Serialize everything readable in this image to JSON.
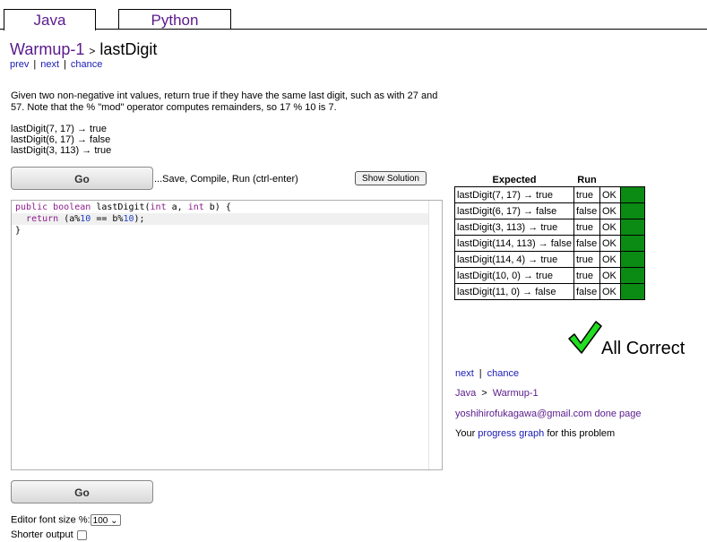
{
  "tabs": [
    {
      "label": "Java"
    },
    {
      "label": "Python"
    }
  ],
  "breadcrumb": {
    "section": "Warmup-1",
    "separator": ">",
    "problem": "lastDigit"
  },
  "nav": {
    "prev": "prev",
    "next": "next",
    "chance": "chance",
    "divider": "|"
  },
  "description": "Given two non-negative int values, return true if they have the same last digit, such as with 27 and 57. Note that the % \"mod\" operator computes remainders, so 17 % 10 is 7.",
  "examples": [
    "lastDigit(7, 17) → true",
    "lastDigit(6, 17) → false",
    "lastDigit(3, 113) → true"
  ],
  "toolbar": {
    "go_label": "Go",
    "save_hint": "...Save, Compile, Run (ctrl-enter)",
    "show_solution_label": "Show Solution"
  },
  "code": {
    "line1": {
      "kw": "public boolean",
      "name": " lastDigit(",
      "t1": "int",
      "a": " a, ",
      "t2": "int",
      "b": " b) {"
    },
    "line2": {
      "kw": "return",
      "p1": " (a%",
      "n1": "10",
      "p2": " == b%",
      "n2": "10",
      "p3": ");"
    },
    "line3": "}"
  },
  "options": {
    "font_size_label": "Editor font size %:",
    "font_size_value": "100",
    "shorter_output_label": "Shorter output"
  },
  "results": {
    "headers": {
      "expected": "Expected",
      "run": "Run"
    },
    "rows": [
      {
        "expected": "lastDigit(7, 17) → true",
        "run": "true",
        "status": "OK"
      },
      {
        "expected": "lastDigit(6, 17) → false",
        "run": "false",
        "status": "OK"
      },
      {
        "expected": "lastDigit(3, 113) → true",
        "run": "true",
        "status": "OK"
      },
      {
        "expected": "lastDigit(114, 113) → false",
        "run": "false",
        "status": "OK"
      },
      {
        "expected": "lastDigit(114, 4) → true",
        "run": "true",
        "status": "OK"
      },
      {
        "expected": "lastDigit(10, 0) → true",
        "run": "true",
        "status": "OK"
      },
      {
        "expected": "lastDigit(11, 0) → false",
        "run": "false",
        "status": "OK"
      }
    ],
    "pass_color": "#0b8a14"
  },
  "verdict": {
    "text": "All Correct",
    "icon": "check-icon",
    "icon_color": "#22dd22"
  },
  "links": {
    "next": "next",
    "chance": "chance",
    "divider": "|",
    "lang": "Java",
    "arrow": ">",
    "section": "Warmup-1",
    "email": "yoshihirofukagawa@gmail.com",
    "done_page": "done page",
    "progress_prefix": "Your",
    "progress_link": "progress graph",
    "progress_suffix": "for this problem"
  }
}
